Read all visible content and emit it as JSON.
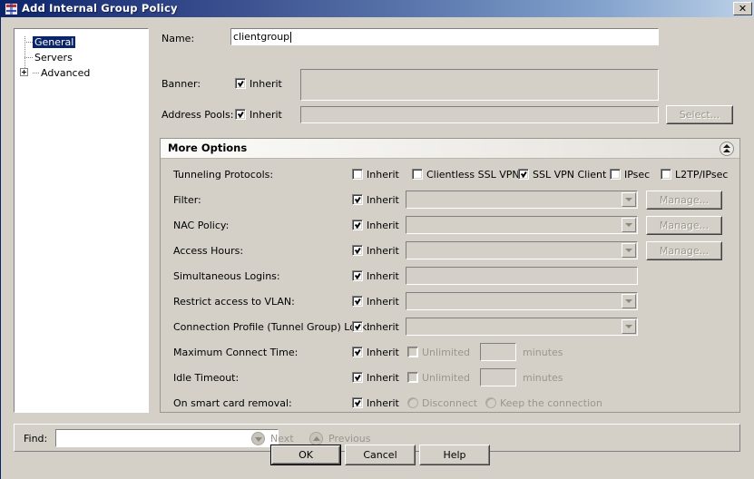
{
  "window": {
    "title": "Add Internal Group Policy",
    "icon": "policy-window-icon",
    "close_label": "✕"
  },
  "tree": {
    "items": [
      {
        "label": "General",
        "selected": true,
        "has_expander": false
      },
      {
        "label": "Servers",
        "selected": false,
        "has_expander": false
      },
      {
        "label": "Advanced",
        "selected": false,
        "has_expander": true
      }
    ]
  },
  "form": {
    "name": {
      "label": "Name:",
      "value": "clientgroup",
      "placeholder": ""
    },
    "banner": {
      "label": "Banner:",
      "inherit_label": "Inherit",
      "inherit_checked": true,
      "value": ""
    },
    "address_pools": {
      "label": "Address Pools:",
      "inherit_label": "Inherit",
      "inherit_checked": true,
      "value": "",
      "select_button": "Select..."
    }
  },
  "more_options": {
    "title": "More Options",
    "collapse_icon": "chevron-double-up-icon",
    "rows": {
      "tunneling_protocols": {
        "label": "Tunneling Protocols:",
        "inherit_label": "Inherit",
        "inherit_checked": false,
        "protocols": [
          {
            "label": "Clientless SSL VPN",
            "checked": false
          },
          {
            "label": "SSL VPN Client",
            "checked": true
          },
          {
            "label": "IPsec",
            "checked": false
          },
          {
            "label": "L2TP/IPsec",
            "checked": false
          }
        ]
      },
      "filter": {
        "label": "Filter:",
        "inherit_label": "Inherit",
        "inherit_checked": true,
        "value": "",
        "manage_button": "Manage..."
      },
      "nac_policy": {
        "label": "NAC Policy:",
        "inherit_label": "Inherit",
        "inherit_checked": true,
        "value": "",
        "manage_button": "Manage..."
      },
      "access_hours": {
        "label": "Access Hours:",
        "inherit_label": "Inherit",
        "inherit_checked": true,
        "value": "",
        "manage_button": "Manage..."
      },
      "simultaneous_logins": {
        "label": "Simultaneous Logins:",
        "inherit_label": "Inherit",
        "inherit_checked": true,
        "value": ""
      },
      "restrict_vlan": {
        "label": "Restrict access to VLAN:",
        "inherit_label": "Inherit",
        "inherit_checked": true,
        "value": ""
      },
      "tunnel_group_lock": {
        "label": "Connection Profile (Tunnel Group) Lock:",
        "inherit_label": "Inherit",
        "inherit_checked": true,
        "value": ""
      },
      "maximum_connect_time": {
        "label": "Maximum Connect Time:",
        "inherit_label": "Inherit",
        "inherit_checked": true,
        "unlimited_label": "Unlimited",
        "unlimited_checked": false,
        "value": "",
        "units_label": "minutes"
      },
      "idle_timeout": {
        "label": "Idle Timeout:",
        "inherit_label": "Inherit",
        "inherit_checked": true,
        "unlimited_label": "Unlimited",
        "unlimited_checked": false,
        "value": "",
        "units_label": "minutes"
      },
      "smart_card_removal": {
        "label": "On smart card removal:",
        "inherit_label": "Inherit",
        "inherit_checked": true,
        "options": [
          {
            "label": "Disconnect",
            "selected": false
          },
          {
            "label": "Keep the connection",
            "selected": false
          }
        ]
      }
    }
  },
  "find_bar": {
    "label": "Find:",
    "value": "",
    "placeholder": "",
    "next_label": "Next",
    "next_icon": "arrow-down-circle-icon",
    "previous_label": "Previous",
    "previous_icon": "arrow-up-circle-icon"
  },
  "buttons": {
    "ok": "OK",
    "cancel": "Cancel",
    "help": "Help"
  },
  "colors": {
    "titlebar_start": "#0a246a",
    "titlebar_end": "#b5cbe4",
    "dialog_face": "#d4d0c8",
    "selection": "#0a246a",
    "disabled_text": "#9a968e",
    "field_white": "#ffffff"
  }
}
